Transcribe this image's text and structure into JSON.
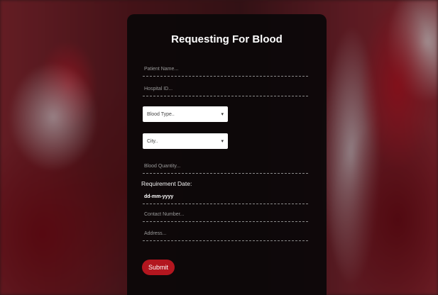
{
  "form": {
    "title": "Requesting For Blood",
    "patient_name_placeholder": "Patient Name...",
    "hospital_id_placeholder": "Hospital ID...",
    "blood_type_select": "Blood Type..",
    "city_select": "City..",
    "blood_quantity_placeholder": "Blood Quantity...",
    "requirement_date_label": "Requirement Date:",
    "requirement_date_value": "dd-mm-yyyy",
    "contact_number_placeholder": "Contact Number...",
    "address_placeholder": "Address...",
    "submit_label": "Submit"
  },
  "icons": {
    "select_chevron": "chevron-down-icon"
  },
  "colors": {
    "panel": "#0a0809",
    "submit": "#b3161f",
    "text": "#ffffff"
  }
}
